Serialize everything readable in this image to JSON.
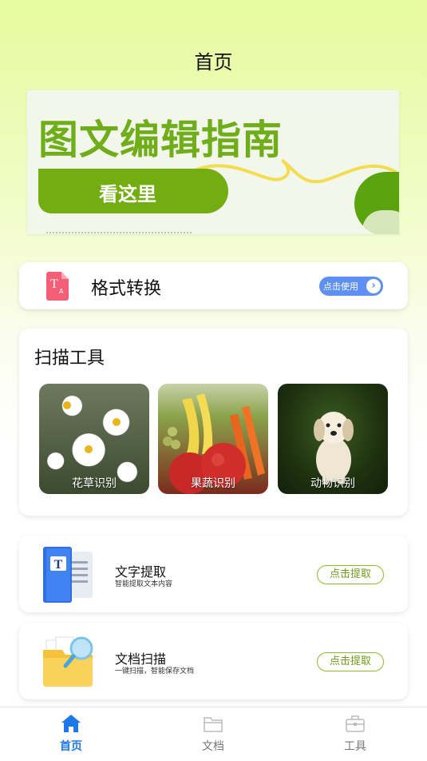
{
  "header": {
    "title": "首页"
  },
  "banner": {
    "heading": "图文编辑指南",
    "button_label": "看这里"
  },
  "format_card": {
    "title": "格式转换",
    "icon_letters": "T",
    "icon_sub": "A",
    "use_label": "点击使用",
    "arrow": "›"
  },
  "scan_tools": {
    "title": "扫描工具",
    "tiles": [
      {
        "label": "花草识别"
      },
      {
        "label": "果蔬识别"
      },
      {
        "label": "动物识别"
      }
    ]
  },
  "tools": [
    {
      "title": "文字提取",
      "subtitle": "智能提取文本内容",
      "button": "点击提取"
    },
    {
      "title": "文档扫描",
      "subtitle": "一键扫描，智能保存文档",
      "button": "点击提取"
    }
  ],
  "tabbar": {
    "items": [
      {
        "label": "首页",
        "icon": "home-icon",
        "active": true
      },
      {
        "label": "文档",
        "icon": "folder-icon",
        "active": false
      },
      {
        "label": "工具",
        "icon": "toolbox-icon",
        "active": false
      }
    ]
  },
  "colors": {
    "accent_green": "#72ad12",
    "active_tab": "#1f78e8",
    "use_button": "#5e8ff2"
  }
}
